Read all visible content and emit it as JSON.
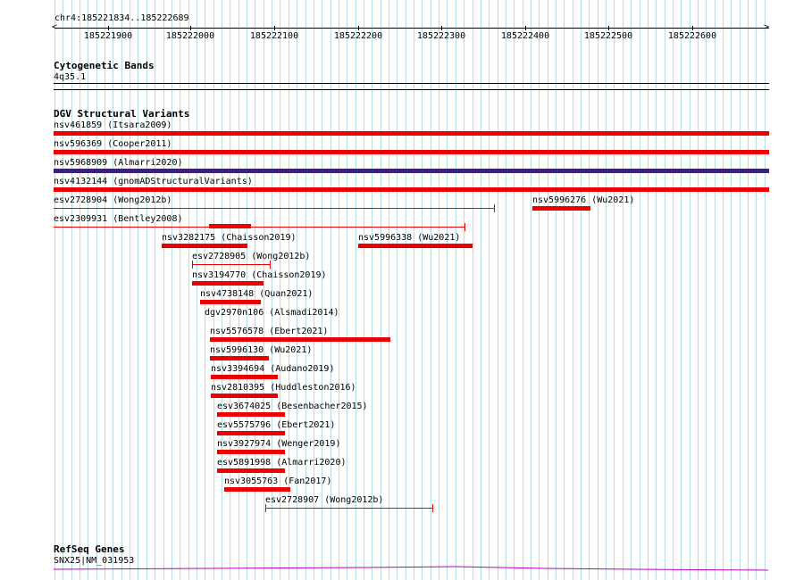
{
  "colors": {
    "grid": "#b6dde3",
    "sv_red": "#ee0000",
    "sv_purple": "#3d1a8e",
    "gene": "#c000c0"
  },
  "ruler": {
    "location": "chr4:185221834..185222689",
    "ticks": [
      "185221900",
      "185222000",
      "185222100",
      "185222200",
      "185222300",
      "185222400",
      "185222500",
      "185222600"
    ]
  },
  "tracks": {
    "cyto": {
      "title": "Cytogenetic Bands",
      "band": "4q35.1"
    },
    "dgv": {
      "title": "DGV Structural Variants"
    },
    "refseq": {
      "title": "RefSeq Genes",
      "gene": "SNX25|NM_031953"
    }
  },
  "variants": [
    {
      "label": "nsv461859 (Itsara2009)"
    },
    {
      "label": "nsv596369 (Cooper2011)"
    },
    {
      "label": "nsv5968909 (Almarri2020)"
    },
    {
      "label": "nsv4132144 (gnomADStructuralVariants)"
    },
    {
      "label": "esv2728904 (Wong2012b)"
    },
    {
      "label": "nsv5996276 (Wu2021)"
    },
    {
      "label": "esv2309931 (Bentley2008)"
    },
    {
      "label": "nsv3282175 (Chaisson2019)"
    },
    {
      "label": "nsv5996338 (Wu2021)"
    },
    {
      "label": "esv2728905 (Wong2012b)"
    },
    {
      "label": "nsv3194770 (Chaisson2019)"
    },
    {
      "label": "nsv4738148 (Quan2021)"
    },
    {
      "label": "dgv2970n106 (Alsmadi2014)"
    },
    {
      "label": "nsv5576578 (Ebert2021)"
    },
    {
      "label": "nsv5996130 (Wu2021)"
    },
    {
      "label": "nsv3394694 (Audano2019)"
    },
    {
      "label": "nsv2810395 (Huddleston2016)"
    },
    {
      "label": "esv3674025 (Besenbacher2015)"
    },
    {
      "label": "esv5575796 (Ebert2021)"
    },
    {
      "label": "nsv3927974 (Wenger2019)"
    },
    {
      "label": "esv5891998 (Almarri2020)"
    },
    {
      "label": "nsv3055763 (Fan2017)"
    },
    {
      "label": "esv2728907 (Wong2012b)"
    }
  ]
}
